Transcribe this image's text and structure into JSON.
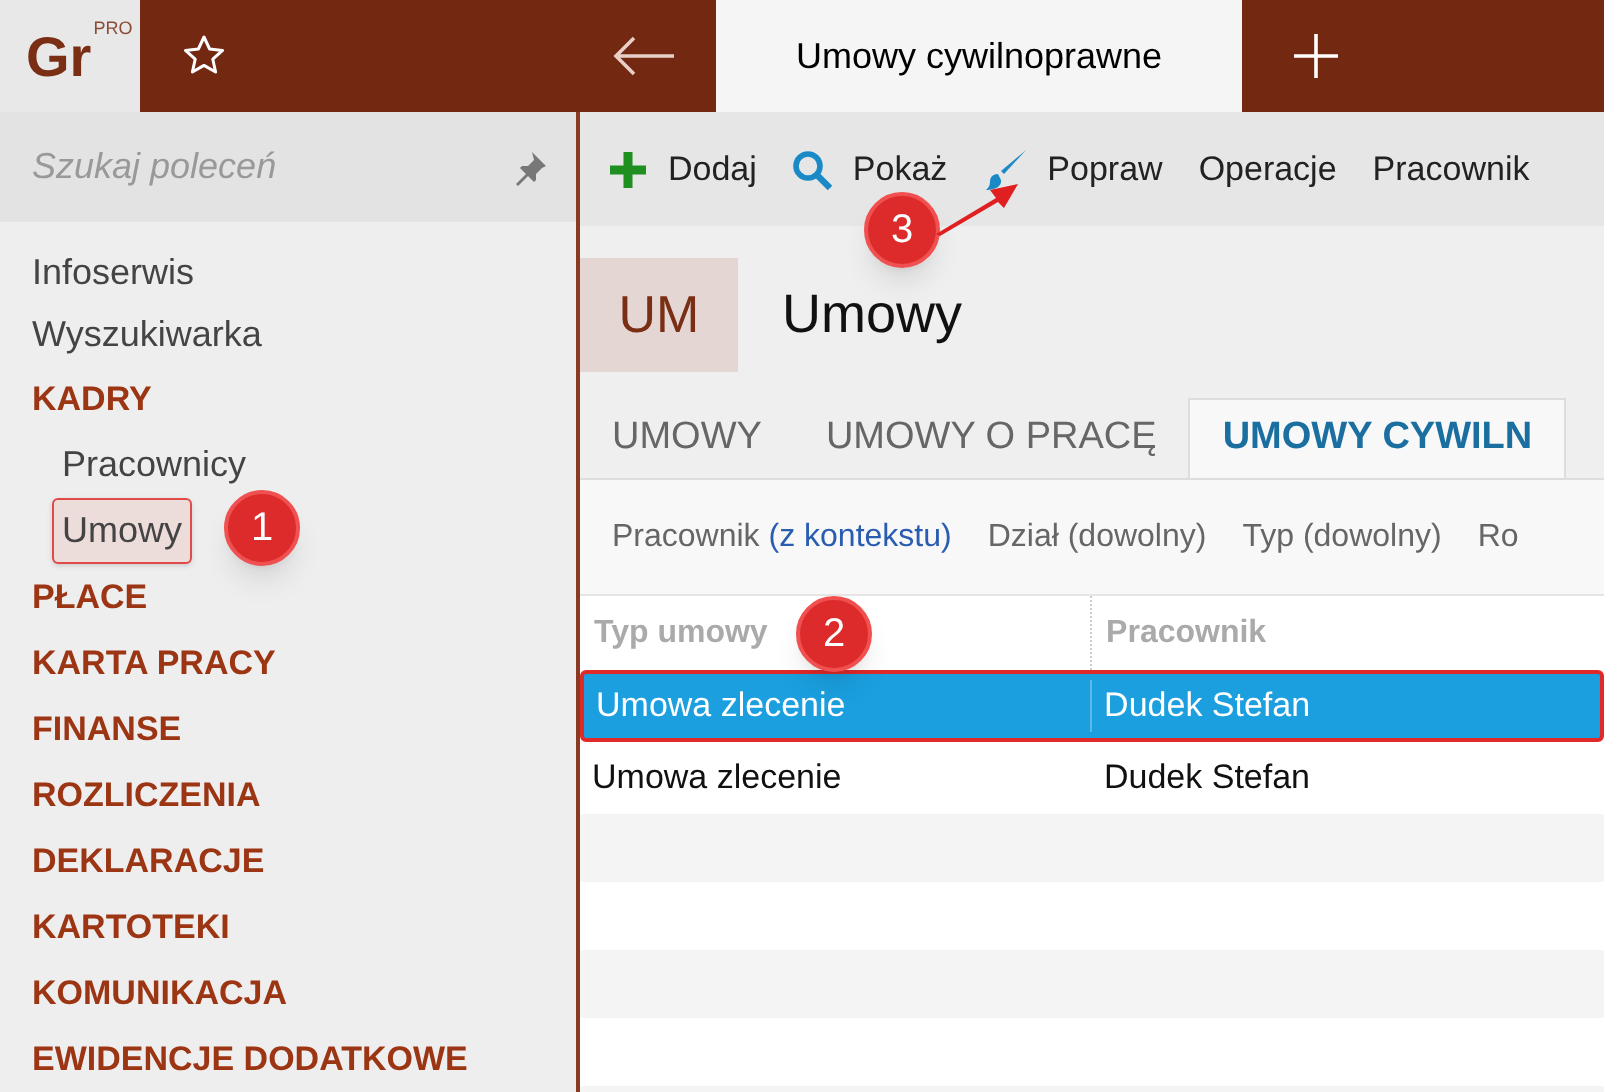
{
  "logo": {
    "text": "Gr",
    "badge": "PRO"
  },
  "tabs": [
    {
      "label": "Umowy cywilnoprawne",
      "selected": true
    }
  ],
  "search": {
    "placeholder": "Szukaj poleceń"
  },
  "sidebar": {
    "items": [
      {
        "label": "Infoserwis",
        "kind": "link",
        "selected": false
      },
      {
        "label": "Wyszukiwarka",
        "kind": "link",
        "selected": false
      },
      {
        "label": "KADRY",
        "kind": "section",
        "selected": false,
        "children": [
          {
            "label": "Pracownicy",
            "selected": false
          },
          {
            "label": "Umowy",
            "selected": true
          }
        ]
      },
      {
        "label": "PŁACE",
        "kind": "section",
        "selected": false
      },
      {
        "label": "KARTA PRACY",
        "kind": "section",
        "selected": false
      },
      {
        "label": "FINANSE",
        "kind": "section",
        "selected": false
      },
      {
        "label": "ROZLICZENIA",
        "kind": "section",
        "selected": false
      },
      {
        "label": "DEKLARACJE",
        "kind": "section",
        "selected": false
      },
      {
        "label": "KARTOTEKI",
        "kind": "section",
        "selected": false
      },
      {
        "label": "KOMUNIKACJA",
        "kind": "section",
        "selected": false
      },
      {
        "label": "EWIDENCJE DODATKOWE",
        "kind": "section",
        "selected": false
      }
    ]
  },
  "toolbar": [
    {
      "label": "Dodaj",
      "kind": "add"
    },
    {
      "label": "Pokaż",
      "kind": "search"
    },
    {
      "label": "Popraw",
      "kind": "brush"
    },
    {
      "label": "Operacje",
      "kind": "text"
    },
    {
      "label": "Pracownik",
      "kind": "text"
    }
  ],
  "page": {
    "code": "UM",
    "title": "Umowy"
  },
  "subtabs": [
    {
      "label": "UMOWY",
      "selected": false
    },
    {
      "label": "UMOWY O PRACĘ",
      "selected": false
    },
    {
      "label": "UMOWY CYWILN",
      "selected": true
    }
  ],
  "filters": [
    {
      "label": "Pracownik",
      "value": "(z kontekstu)"
    },
    {
      "label": "Dział (dowolny)"
    },
    {
      "label": "Typ (dowolny)"
    },
    {
      "label": "Ro"
    }
  ],
  "table": {
    "columns": [
      "Typ umowy",
      "Pracownik"
    ],
    "rows": [
      {
        "cells": [
          "Umowa zlecenie",
          "Dudek Stefan"
        ],
        "selected": true
      },
      {
        "cells": [
          "Umowa zlecenie",
          "Dudek Stefan"
        ],
        "selected": false
      }
    ]
  },
  "annotations": [
    {
      "label": "1"
    },
    {
      "label": "2"
    },
    {
      "label": "3"
    }
  ]
}
